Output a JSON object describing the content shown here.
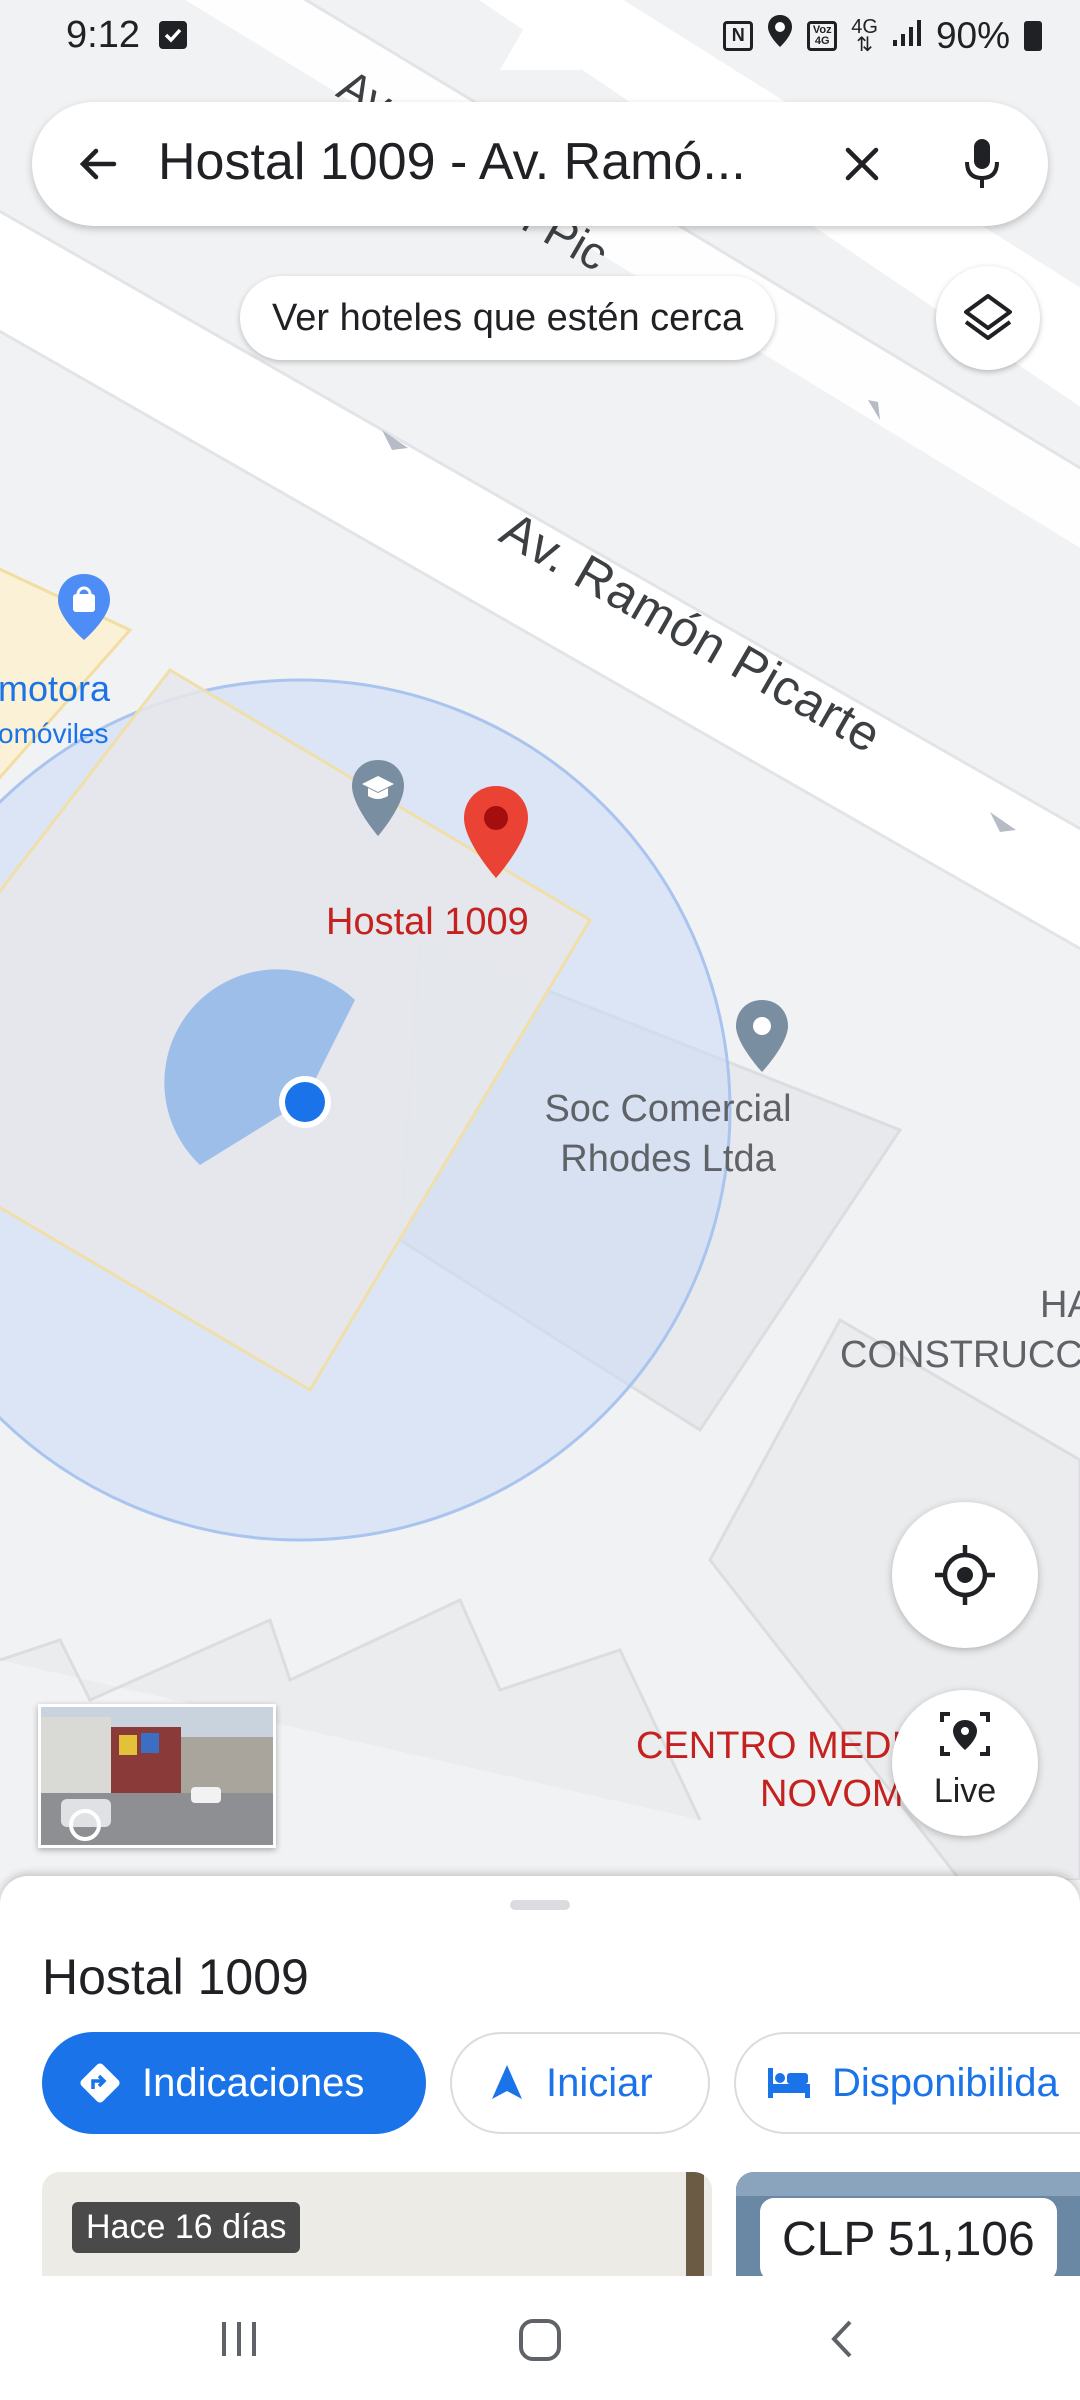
{
  "status_bar": {
    "time": "9:12",
    "battery": "90%",
    "network_badge": "Voz 4G",
    "network": "4G"
  },
  "search": {
    "query": "Hostal 1009 - Av. Ramó..."
  },
  "chip": {
    "label": "Ver hoteles que estén cerca"
  },
  "map": {
    "street_main": "Av. Ramón Picarte",
    "street_top_1": "Av.",
    "street_top_2": "ı Pic",
    "poi_left_1": "motora",
    "poi_left_2": "omóviles",
    "marker_label": "Hostal 1009",
    "poi_shop_line1": "Soc Comercial",
    "poi_shop_line2": "Rhodes Ltda",
    "poi_right_1": "HA",
    "poi_right_2": "CONSTRUCC",
    "poi_med_1": "CENTRO MEDI",
    "poi_med_2": "NOVOM",
    "live_label": "Live"
  },
  "sheet": {
    "place_name": "Hostal 1009",
    "buttons": {
      "directions": "Indicaciones",
      "start": "Iniciar",
      "availability": "Disponibilida"
    },
    "photo_badge": "Hace 16 días",
    "price": "CLP 51,106"
  },
  "colors": {
    "accent": "#1a73e8",
    "marker_red": "#ea4335",
    "accuracy_circle": "#c9dbf6"
  },
  "icons": [
    "back-arrow-icon",
    "close-icon",
    "mic-icon",
    "layers-icon",
    "my-location-icon",
    "live-view-icon",
    "directions-icon",
    "navigation-icon",
    "bed-icon"
  ]
}
